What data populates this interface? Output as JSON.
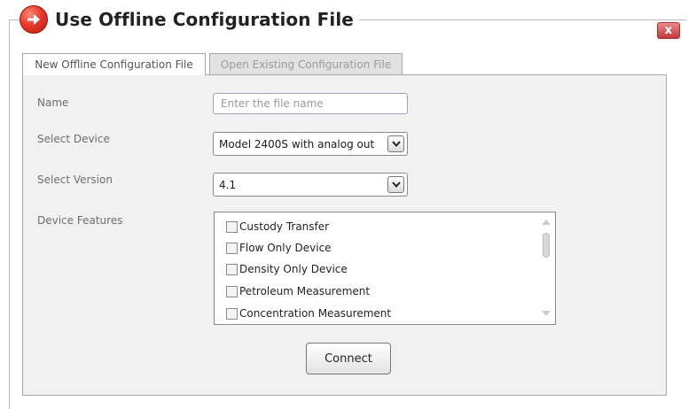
{
  "window": {
    "title": "Use Offline Configuration File",
    "close_label": "x",
    "title_icon": "arrow-right-circle-icon",
    "accent_color": "#e63a2a"
  },
  "tabs": [
    {
      "label": "New Offline Configuration File",
      "active": true
    },
    {
      "label": "Open Existing Configuration File",
      "active": false
    }
  ],
  "form": {
    "name_label": "Name",
    "name_placeholder": "Enter the file name",
    "name_value": "",
    "device_label": "Select Device",
    "device_value": "Model 2400S with analog out",
    "version_label": "Select Version",
    "version_value": "4.1",
    "features_label": "Device Features",
    "features": [
      {
        "label": "Custody Transfer",
        "checked": false
      },
      {
        "label": "Flow Only Device",
        "checked": false
      },
      {
        "label": "Density Only Device",
        "checked": false
      },
      {
        "label": "Petroleum Measurement",
        "checked": false
      },
      {
        "label": "Concentration Measurement",
        "checked": false
      }
    ]
  },
  "actions": {
    "connect_label": "Connect"
  }
}
